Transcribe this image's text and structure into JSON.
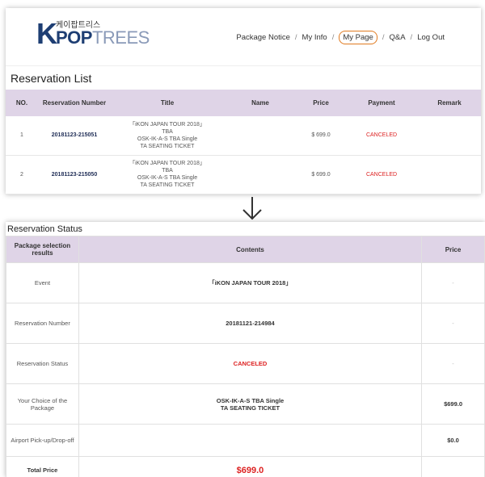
{
  "header": {
    "logo_korean": "케이팝트리스",
    "logo_k": "K",
    "logo_pop": "POP",
    "logo_trees": "TREES",
    "nav": [
      "Package Notice",
      "My Info",
      "My Page",
      "Q&A",
      "Log Out"
    ],
    "nav_separator": "/",
    "active_nav": "My Page",
    "highlight_color": "#e07a1f"
  },
  "reservation_list": {
    "title": "Reservation List",
    "columns": [
      "NO.",
      "Reservation Number",
      "Title",
      "Name",
      "Price",
      "Payment",
      "Remark"
    ],
    "rows": [
      {
        "no": "1",
        "number": "20181123-215051",
        "title_lines": [
          "「iKON JAPAN TOUR 2018」",
          "TBA",
          "OSK-IK-A-S TBA Single",
          "TA SEATING TICKET"
        ],
        "name": "",
        "price": "$ 699.0",
        "payment": "CANCELED",
        "remark": ""
      },
      {
        "no": "2",
        "number": "20181123-215050",
        "title_lines": [
          "「iKON JAPAN TOUR 2018」",
          "TBA",
          "OSK-IK-A-S TBA Single",
          "TA SEATING TICKET"
        ],
        "name": "",
        "price": "$ 699.0",
        "payment": "CANCELED",
        "remark": ""
      }
    ]
  },
  "reservation_status": {
    "title": "Reservation Status",
    "columns": [
      "Package selection results",
      "Contents",
      "Price"
    ],
    "rows": {
      "event": {
        "label": "Event",
        "content": "「iKON JAPAN TOUR 2018」",
        "price": "-"
      },
      "number": {
        "label": "Reservation Number",
        "content": "20181121-214984",
        "price": "-"
      },
      "status": {
        "label": "Reservation Status",
        "content": "CANCELED",
        "price": "-"
      },
      "package": {
        "label": "Your Choice of the Package",
        "content_lines": [
          "OSK-IK-A-S TBA Single",
          "TA SEATING TICKET"
        ],
        "price": "$699.0"
      },
      "airport": {
        "label": "Airport Pick-up/Drop-off",
        "content": "",
        "price": "$0.0"
      },
      "total": {
        "label": "Total Price",
        "content": "$699.0"
      }
    }
  },
  "colors": {
    "header_bg": "#dfd4e7",
    "brand": "#1e3e73",
    "canceled": "#d22222"
  },
  "icons": {
    "arrow": "down-arrow-icon"
  }
}
